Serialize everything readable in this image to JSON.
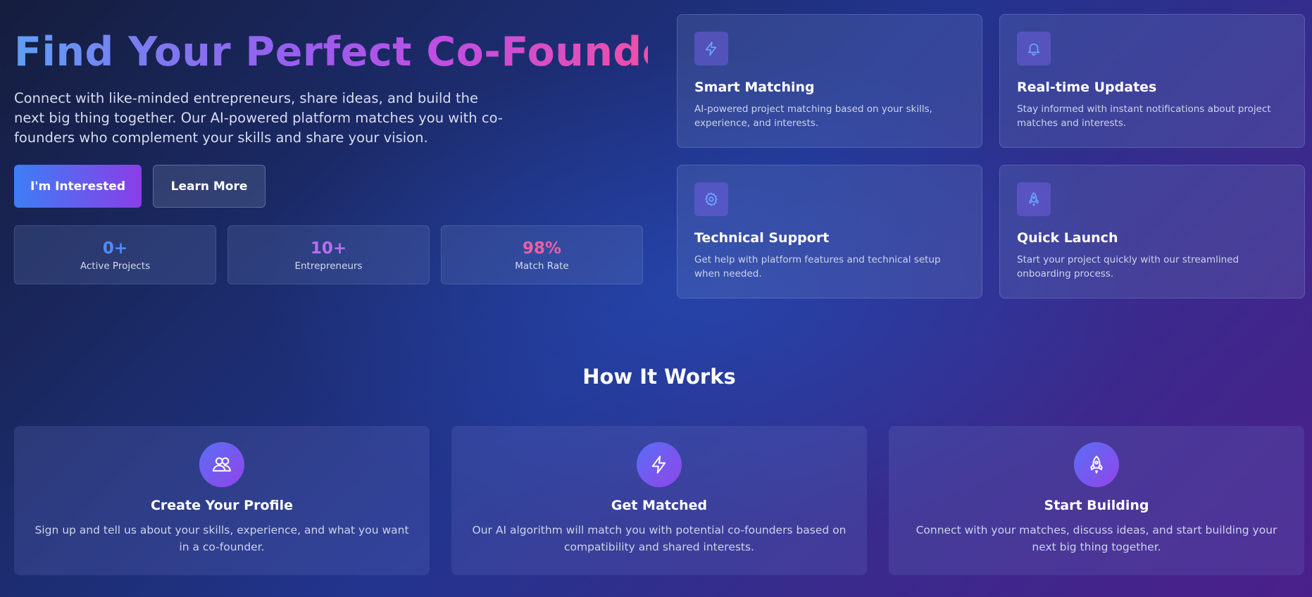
{
  "hero": {
    "title": "Find Your Perfect Co-Founder",
    "description": "Connect with like-minded entrepreneurs, share ideas, and build the next big thing together. Our AI-powered platform matches you with co-founders who complement your skills and share your vision.",
    "primary_button": "I'm Interested",
    "secondary_button": "Learn More"
  },
  "stats": [
    {
      "value": "0+",
      "label": "Active Projects",
      "color": "#4f8cf6"
    },
    {
      "value": "10+",
      "label": "Entrepreneurs",
      "color": "#b66ef0"
    },
    {
      "value": "98%",
      "label": "Match Rate",
      "color": "#ec5fa5"
    }
  ],
  "features": [
    {
      "icon": "lightning-icon",
      "title": "Smart Matching",
      "description": "AI-powered project matching based on your skills, experience, and interests."
    },
    {
      "icon": "bell-icon",
      "title": "Real-time Updates",
      "description": "Stay informed with instant notifications about project matches and interests."
    },
    {
      "icon": "gear-icon",
      "title": "Technical Support",
      "description": "Get help with platform features and technical setup when needed."
    },
    {
      "icon": "rocket-icon",
      "title": "Quick Launch",
      "description": "Start your project quickly with our streamlined onboarding process."
    }
  ],
  "how_it_works": {
    "title": "How It Works",
    "steps": [
      {
        "icon": "users-icon",
        "title": "Create Your Profile",
        "description": "Sign up and tell us about your skills, experience, and what you want in a co-founder."
      },
      {
        "icon": "lightning-icon",
        "title": "Get Matched",
        "description": "Our AI algorithm will match you with potential co-founders based on compatibility and shared interests."
      },
      {
        "icon": "rocket-icon",
        "title": "Start Building",
        "description": "Connect with your matches, discuss ideas, and start building your next big thing together."
      }
    ]
  },
  "colors": {
    "accent_blue": "#3d7ef5",
    "accent_purple": "#8a3ee8",
    "icon_stroke": "#6aa6ff"
  }
}
